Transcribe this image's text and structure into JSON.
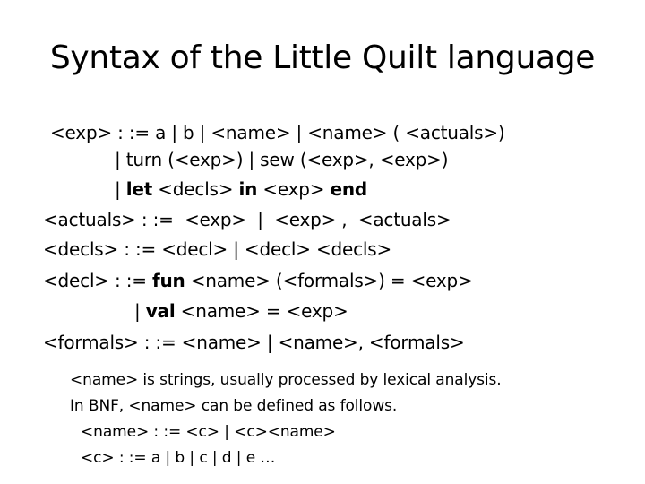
{
  "slide": {
    "title": "Syntax of the Little Quilt language"
  },
  "grammar": {
    "line1": "<exp> : := a | b | <name> | <name> ( <actuals>)",
    "line2": "| turn (<exp>) | sew (<exp>, <exp>)",
    "line3_pre": "| ",
    "line3_kw1": "let",
    "line3_mid1": " <decls> ",
    "line3_kw2": "in",
    "line3_mid2": " <exp> ",
    "line3_kw3": "end",
    "line4": "<actuals> : :=  <exp>  |  <exp> ,  <actuals>",
    "line5": "<decls> : := <decl> | <decl> <decls>",
    "line6_pre": "<decl> : := ",
    "line6_kw": "fun",
    "line6_post": " <name> (<formals>) = <exp>",
    "line7_pre": "| ",
    "line7_kw": "val",
    "line7_post": " <name> = <exp>",
    "line8": "<formals> : := <name> | <name>, <formals>"
  },
  "notes": {
    "line1": "<name> is strings, usually processed by lexical analysis.",
    "line2": "In BNF, <name> can be defined as follows.",
    "line3": "<name> : := <c> | <c><name>",
    "line4": "<c> : := a | b | c | d | e …"
  }
}
